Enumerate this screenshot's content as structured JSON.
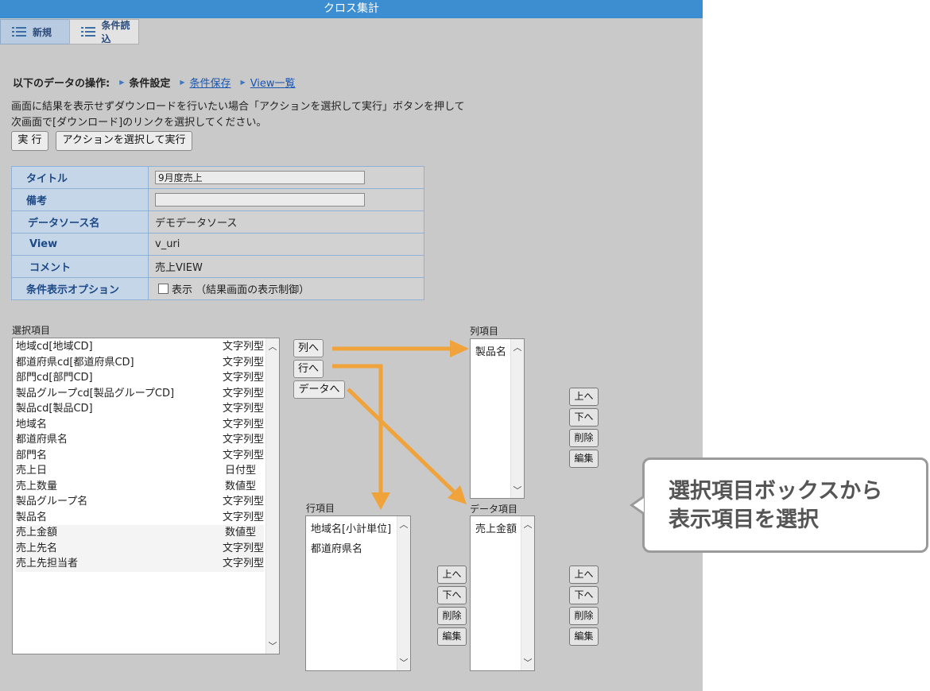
{
  "window": {
    "title": "クロス集計"
  },
  "toolbar": {
    "new_label": "新規",
    "load_label": "条件読込"
  },
  "ops": {
    "label": "以下のデータの操作:",
    "current": "条件設定",
    "save_link": "条件保存",
    "view_link": "View一覧"
  },
  "notice": {
    "line1": "画面に結果を表示せずダウンロードを行いたい場合「アクションを選択して実行」ボタンを押して",
    "line2": "次画面で[ダウンロード]のリンクを選択してください。"
  },
  "actions": {
    "run_label": "実 行",
    "select_action_label": "アクションを選択して実行"
  },
  "condition_table": {
    "title_label": "タイトル",
    "title_value": "9月度売上",
    "note_label": "備考",
    "note_value": "",
    "datasource_label": "データソース名",
    "datasource_value": "デモデータソース",
    "view_label": "View",
    "view_value": "v_uri",
    "comment_label": "コメント",
    "comment_value": "売上VIEW",
    "option_label": "条件表示オプション",
    "option_value": "表示 （結果画面の表示制御）"
  },
  "selection": {
    "label": "選択項目",
    "items": [
      {
        "name": "地域cd[地域CD]",
        "type": "文字列型"
      },
      {
        "name": "都道府県cd[都道府県CD]",
        "type": "文字列型"
      },
      {
        "name": "部門cd[部門CD]",
        "type": "文字列型"
      },
      {
        "name": "製品グループcd[製品グループCD]",
        "type": "文字列型"
      },
      {
        "name": "製品cd[製品CD]",
        "type": "文字列型"
      },
      {
        "name": "地域名",
        "type": "文字列型"
      },
      {
        "name": "都道府県名",
        "type": "文字列型"
      },
      {
        "name": "部門名",
        "type": "文字列型"
      },
      {
        "name": "売上日",
        "type": "日付型"
      },
      {
        "name": "売上数量",
        "type": "数値型"
      },
      {
        "name": "製品グループ名",
        "type": "文字列型"
      },
      {
        "name": "製品名",
        "type": "文字列型"
      },
      {
        "name": "売上金額",
        "type": "数値型"
      },
      {
        "name": "売上先名",
        "type": "文字列型"
      },
      {
        "name": "売上先担当者",
        "type": "文字列型"
      }
    ]
  },
  "move_buttons": {
    "to_column": "列へ",
    "to_row": "行へ",
    "to_data": "データへ"
  },
  "column_box": {
    "label": "列項目",
    "items": [
      "製品名"
    ]
  },
  "row_box": {
    "label": "行項目",
    "items": [
      "地域名[小計単位]",
      "都道府県名"
    ]
  },
  "data_box": {
    "label": "データ項目",
    "items": [
      "売上金額"
    ]
  },
  "list_buttons": {
    "up": "上へ",
    "down": "下へ",
    "delete": "削除",
    "edit": "編集"
  },
  "callout": {
    "line1": "選択項目ボックスから",
    "line2": "表示項目を選択"
  },
  "colors": {
    "titlebar": "#3d8ed0",
    "background": "#c9c9c9",
    "arrow": "#f0a33a",
    "table_key_bg": "#c5d6e8"
  },
  "icons": {
    "toolbar": "list-icon"
  }
}
